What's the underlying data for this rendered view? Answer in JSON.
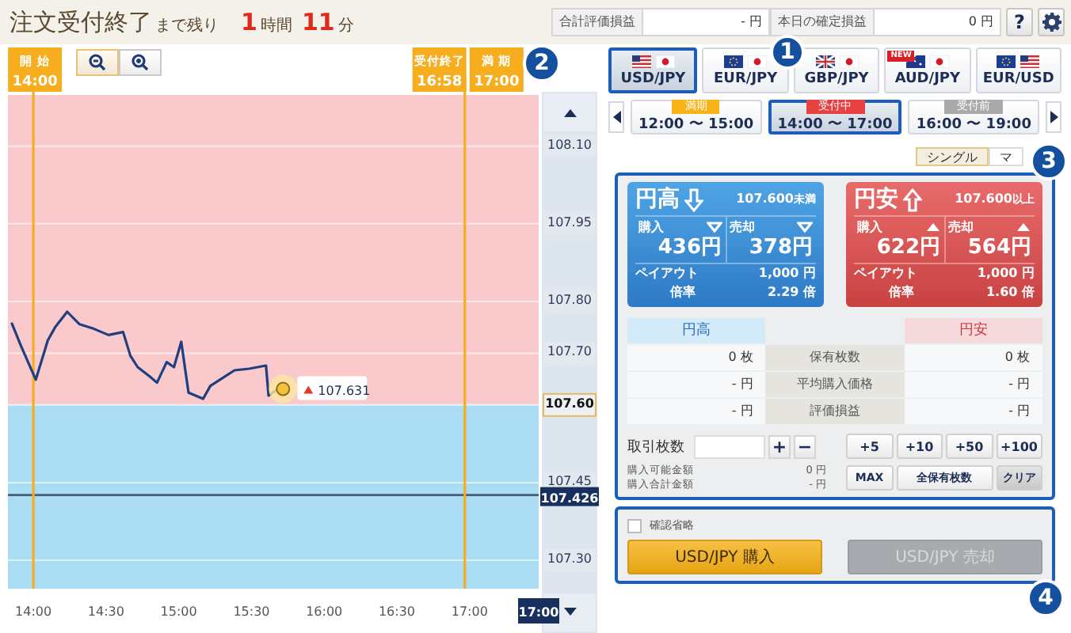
{
  "header": {
    "countdown": {
      "title": "注文受付終了",
      "suffix": "まで残り",
      "hours": "1",
      "hours_unit": "時間",
      "minutes": "11",
      "minutes_unit": "分"
    },
    "summary": [
      {
        "label": "合計評価損益",
        "value": "- 円"
      },
      {
        "label": "本日の確定損益",
        "value": "0 円"
      }
    ],
    "help_button": "?"
  },
  "chart": {
    "markers": [
      {
        "label": "開 始",
        "time": "14:00"
      },
      {
        "label": "受付終了",
        "time": "16:58"
      },
      {
        "label": "満 期",
        "time": "17:00"
      }
    ],
    "current_price": "107.631",
    "reference_price": "107.426",
    "axis_end_time": "17:00",
    "chart_data": {
      "type": "line",
      "x": [
        13.85,
        13.917,
        14.017,
        14.1,
        14.15,
        14.233,
        14.317,
        14.417,
        14.517,
        14.617,
        14.667,
        14.717,
        14.8,
        14.85,
        14.917,
        14.967,
        15.017,
        15.067,
        15.167,
        15.217,
        15.3,
        15.383,
        15.483,
        15.6,
        15.617,
        15.683,
        15.717
      ],
      "series": [
        {
          "color": "#1f3f80",
          "values": [
            107.759,
            107.713,
            107.649,
            107.725,
            107.75,
            107.78,
            107.756,
            107.747,
            107.735,
            107.741,
            107.695,
            107.673,
            107.655,
            107.643,
            107.683,
            107.673,
            107.722,
            107.624,
            107.612,
            107.637,
            107.652,
            107.667,
            107.67,
            107.676,
            107.618,
            107.631,
            107.631
          ]
        }
      ],
      "grid": true,
      "bands": [
        {
          "axis": "y",
          "from": 107.6,
          "to": 108.199,
          "color": "#f9c9cb"
        },
        {
          "axis": "y",
          "from": 107.245,
          "to": 107.6,
          "color": "#aadcf3"
        }
      ],
      "ref_lines": [
        {
          "axis": "y",
          "value": 107.426,
          "color": "#46607a"
        },
        {
          "axis": "x",
          "value": 14,
          "color": "#f6ae1e"
        },
        {
          "axis": "x",
          "value": 16.967,
          "color": "#f6ae1e"
        }
      ],
      "xlim": [
        13.825,
        17.475
      ],
      "ylim": [
        107.245,
        108.199
      ],
      "xticks": [
        {
          "value": 14,
          "label": "14:00"
        },
        {
          "value": 14.5,
          "label": "14:30"
        },
        {
          "value": 15,
          "label": "15:00"
        },
        {
          "value": 15.5,
          "label": "15:30"
        },
        {
          "value": 16,
          "label": "16:00"
        },
        {
          "value": 16.5,
          "label": "16:30"
        },
        {
          "value": 17,
          "label": "17:00"
        }
      ],
      "yticks": [
        {
          "value": 108.1,
          "label": "108.10"
        },
        {
          "value": 107.95,
          "label": "107.95"
        },
        {
          "value": 107.8,
          "label": "107.80"
        },
        {
          "value": 107.7,
          "label": "107.70"
        },
        {
          "value": 107.6,
          "label": "107.60"
        },
        {
          "value": 107.45,
          "label": "107.45"
        },
        {
          "value": 107.3,
          "label": "107.30"
        }
      ]
    }
  },
  "currency_tabs": [
    {
      "pair": "USD/JPY",
      "selected": true
    },
    {
      "pair": "EUR/JPY",
      "selected": false
    },
    {
      "pair": "GBP/JPY",
      "selected": false
    },
    {
      "pair": "AUD/JPY",
      "selected": false,
      "badge": "NEW"
    },
    {
      "pair": "EUR/USD",
      "selected": false
    }
  ],
  "sessions": [
    {
      "status": "満期",
      "kind": "expired",
      "time": "12:00 〜 15:00",
      "selected": false
    },
    {
      "status": "受付中",
      "kind": "open",
      "time": "14:00 〜 17:00",
      "selected": true
    },
    {
      "status": "受付前",
      "kind": "upcoming",
      "time": "16:00 〜 19:00",
      "selected": false
    }
  ],
  "mode_tabs": [
    {
      "label": "シングル",
      "selected": true
    },
    {
      "label": "マ",
      "selected": false
    }
  ],
  "options": [
    {
      "kind": "high",
      "title": "円高",
      "threshold": "107.600",
      "threshold_unit": "未満",
      "buy_label": "購入",
      "buy_price": "436円",
      "sell_label": "売却",
      "sell_price": "378円",
      "payout_label": "ペイアウト",
      "payout": "1,000 円",
      "rate_label": "倍率",
      "rate": "2.29 倍"
    },
    {
      "kind": "low",
      "title": "円安",
      "threshold": "107.600",
      "threshold_unit": "以上",
      "buy_label": "購入",
      "buy_price": "622円",
      "sell_label": "売却",
      "sell_price": "564円",
      "payout_label": "ペイアウト",
      "payout": "1,000 円",
      "rate_label": "倍率",
      "rate": "1.60 倍"
    }
  ],
  "position_table": {
    "high_header": "円高",
    "low_header": "円安",
    "rows": [
      {
        "high": "0 枚",
        "label": "保有枚数",
        "low": "0 枚"
      },
      {
        "high": "- 円",
        "label": "平均購入価格",
        "low": "- 円"
      },
      {
        "high": "- 円",
        "label": "評価損益",
        "low": "- 円"
      }
    ]
  },
  "trade": {
    "quantity_label": "取引枚数",
    "plus": "+",
    "minus": "−",
    "available_label": "購入可能金額",
    "available": "0 円",
    "total_label": "購入合計金額",
    "total": "- 円",
    "quick_buttons": [
      {
        "label": "+5",
        "kind": "add"
      },
      {
        "label": "+10",
        "kind": "add"
      },
      {
        "label": "+50",
        "kind": "add"
      },
      {
        "label": "+100",
        "kind": "add"
      },
      {
        "label": "MAX",
        "kind": "max"
      },
      {
        "label": "全保有枚数",
        "kind": "all"
      },
      {
        "label": "クリア",
        "kind": "clear"
      }
    ]
  },
  "confirm": {
    "label": "確認省略",
    "checked": false
  },
  "order_buttons": [
    {
      "label": "USD/JPY 購入",
      "kind": "buy",
      "disabled": false
    },
    {
      "label": "USD/JPY 売却",
      "kind": "sell",
      "disabled": true
    }
  ],
  "callouts": [
    "1",
    "2",
    "3",
    "4"
  ]
}
